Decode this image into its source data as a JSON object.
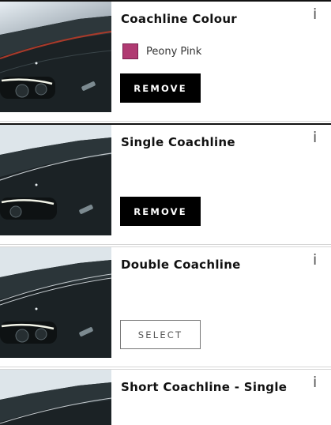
{
  "colors": {
    "accent": "#000000",
    "swatch_peony_pink": "#b03a72"
  },
  "info_glyph": "i",
  "options": [
    {
      "title": "Coachline Colour",
      "swatch_label": "Peony Pink",
      "button_label": "REMOVE",
      "state": "selected"
    },
    {
      "title": "Single Coachline",
      "button_label": "REMOVE",
      "state": "selected"
    },
    {
      "title": "Double Coachline",
      "button_label": "SELECT",
      "state": "unselected"
    },
    {
      "title": "Short Coachline - Single",
      "state": "unselected"
    }
  ]
}
